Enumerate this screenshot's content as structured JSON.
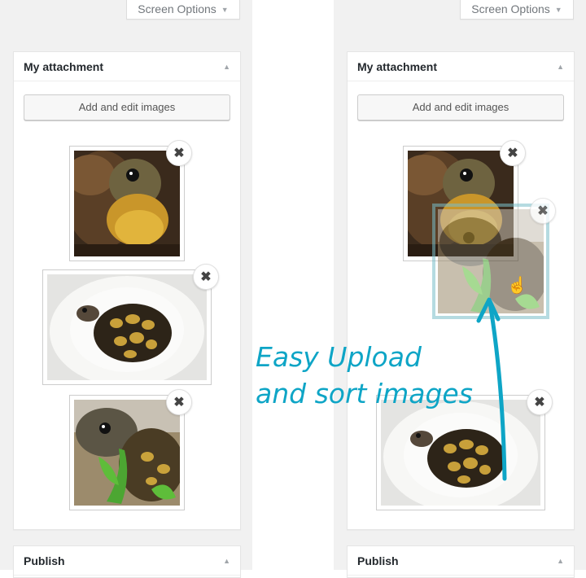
{
  "screen_options": {
    "label": "Screen Options"
  },
  "metabox": {
    "title": "My attachment",
    "add_button": "Add and edit images"
  },
  "publish": {
    "title": "Publish"
  },
  "annotation": {
    "line1": "Easy Upload",
    "line2": "and sort images"
  },
  "colors": {
    "accent": "#0ea5c6",
    "background": "#f1f1f1"
  },
  "images": [
    {
      "subject": "tortoise-head-closeup"
    },
    {
      "subject": "tortoise-in-bowl"
    },
    {
      "subject": "tortoise-eating-leaf"
    }
  ]
}
